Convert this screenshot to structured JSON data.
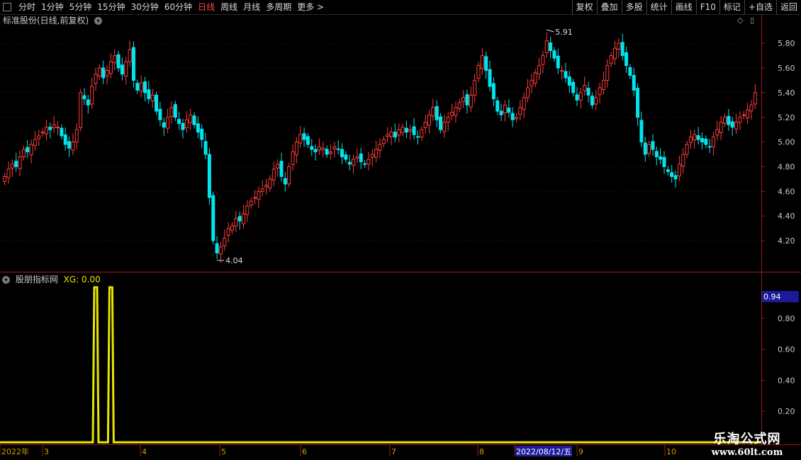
{
  "toolbar": {
    "tabs": [
      {
        "label": "分时",
        "active": false
      },
      {
        "label": "1分钟",
        "active": false
      },
      {
        "label": "5分钟",
        "active": false
      },
      {
        "label": "15分钟",
        "active": false
      },
      {
        "label": "30分钟",
        "active": false
      },
      {
        "label": "60分钟",
        "active": false
      },
      {
        "label": "日线",
        "active": true
      },
      {
        "label": "周线",
        "active": false
      },
      {
        "label": "月线",
        "active": false
      },
      {
        "label": "多周期",
        "active": false
      },
      {
        "label": "更多 >",
        "active": false
      }
    ],
    "right_buttons": [
      "复权",
      "叠加",
      "多股",
      "统计",
      "画线",
      "F10",
      "标记",
      "+自选",
      "返回"
    ]
  },
  "main_chart": {
    "title": "标准股份(日线,前复权)",
    "y_ticks": [
      "5.80",
      "5.60",
      "5.40",
      "5.20",
      "5.00",
      "4.80",
      "4.60",
      "4.40",
      "4.20"
    ],
    "high_label": "5.91",
    "low_label": "4.04"
  },
  "indicator": {
    "name": "股朋指标网",
    "value_text": "XG: 0.00",
    "current_value": "0.94",
    "y_ticks": [
      "0.80",
      "0.60",
      "0.40",
      "0.20"
    ]
  },
  "x_axis": {
    "labels": [
      "2022年",
      "3",
      "4",
      "5",
      "6",
      "7",
      "8",
      "2022/08/12/五",
      "9",
      "10"
    ]
  },
  "watermark": {
    "line1": "乐淘公式网",
    "line2": "www.60lt.com"
  },
  "colors": {
    "up": "#ff3c3c",
    "down": "#00e5ee",
    "indicator": "#e6e600",
    "frame": "#a01818",
    "highlight_bg": "#1a1a9a"
  },
  "chart_data": {
    "type": "candlestick",
    "ylim": [
      4.04,
      5.91
    ],
    "high": 5.91,
    "low": 4.04,
    "closes": [
      4.72,
      4.78,
      4.82,
      4.8,
      4.88,
      4.94,
      4.92,
      4.98,
      5.02,
      5.05,
      5.08,
      5.12,
      5.1,
      5.14,
      5.12,
      5.05,
      4.98,
      4.95,
      5.0,
      5.1,
      5.4,
      5.35,
      5.3,
      5.45,
      5.55,
      5.6,
      5.52,
      5.58,
      5.65,
      5.7,
      5.6,
      5.55,
      5.65,
      5.75,
      5.5,
      5.42,
      5.48,
      5.4,
      5.35,
      5.38,
      5.25,
      5.18,
      5.12,
      5.2,
      5.28,
      5.2,
      5.15,
      5.1,
      5.18,
      5.22,
      5.14,
      5.08,
      5.02,
      4.9,
      4.55,
      4.2,
      4.1,
      4.15,
      4.22,
      4.3,
      4.32,
      4.38,
      4.36,
      4.42,
      4.48,
      4.52,
      4.55,
      4.6,
      4.62,
      4.65,
      4.7,
      4.78,
      4.82,
      4.72,
      4.66,
      4.8,
      4.92,
      5.0,
      5.06,
      5.02,
      4.98,
      4.94,
      4.92,
      4.96,
      4.95,
      4.9,
      4.92,
      4.96,
      4.94,
      4.88,
      4.86,
      4.82,
      4.86,
      4.88,
      4.84,
      4.82,
      4.86,
      4.9,
      4.94,
      4.98,
      5.02,
      5.06,
      5.08,
      5.04,
      5.1,
      5.12,
      5.08,
      5.1,
      5.06,
      5.04,
      5.1,
      5.16,
      5.22,
      5.28,
      5.18,
      5.1,
      5.16,
      5.2,
      5.24,
      5.28,
      5.32,
      5.36,
      5.3,
      5.38,
      5.5,
      5.62,
      5.7,
      5.58,
      5.45,
      5.35,
      5.25,
      5.22,
      5.3,
      5.24,
      5.18,
      5.2,
      5.28,
      5.36,
      5.44,
      5.5,
      5.56,
      5.62,
      5.7,
      5.82,
      5.74,
      5.68,
      5.6,
      5.58,
      5.52,
      5.46,
      5.4,
      5.34,
      5.4,
      5.46,
      5.38,
      5.3,
      5.36,
      5.44,
      5.5,
      5.62,
      5.7,
      5.76,
      5.8,
      5.7,
      5.62,
      5.54,
      5.42,
      5.2,
      5.0,
      4.9,
      4.98,
      4.94,
      4.88,
      4.86,
      4.8,
      4.76,
      4.72,
      4.7,
      4.82,
      4.9,
      4.98,
      5.04,
      5.06,
      5.02,
      5.0,
      4.98,
      4.96,
      5.04,
      5.1,
      5.16,
      5.2,
      5.14,
      5.12,
      5.16,
      5.2,
      5.22,
      5.26,
      5.3,
      5.4
    ],
    "indicator_series": {
      "name": "XG",
      "pulses_at_index": [
        24,
        28
      ],
      "peak": 1.0,
      "base": 0.0
    },
    "indicator_ylim": [
      0,
      1.0
    ]
  }
}
